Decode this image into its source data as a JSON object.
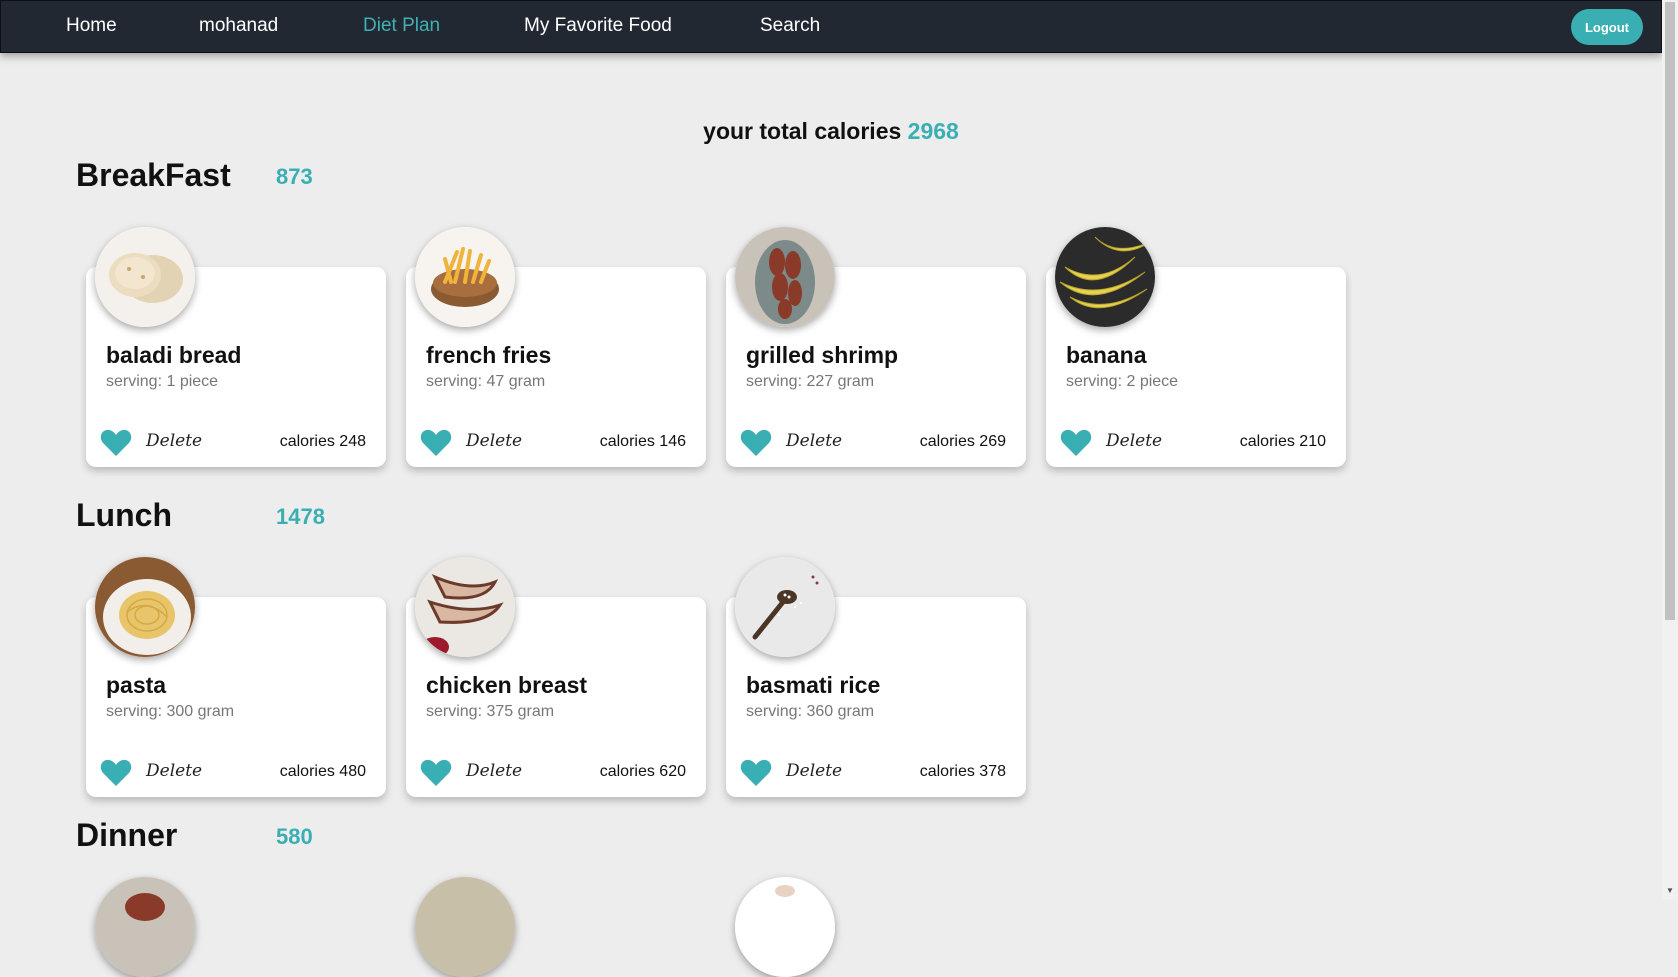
{
  "nav": {
    "items": [
      "Home",
      "mohanad",
      "Diet Plan",
      "My Favorite Food",
      "Search"
    ],
    "active": "Diet Plan",
    "logout_label": "Logout"
  },
  "colors": {
    "accent": "#3aafb3",
    "navbar": "#222831",
    "background": "#ededed"
  },
  "summary": {
    "label": "your total calories",
    "total": "2968"
  },
  "delete_label": "Delete",
  "meals": [
    {
      "title": "BreakFast",
      "calories": "873",
      "foods": [
        {
          "name": "baladi bread",
          "serving": "serving: 1 piece",
          "calories": "calories 248",
          "icon": "baladi-bread-image"
        },
        {
          "name": "french fries",
          "serving": "serving: 47 gram",
          "calories": "calories 146",
          "icon": "french-fries-image"
        },
        {
          "name": "grilled shrimp",
          "serving": "serving: 227 gram",
          "calories": "calories 269",
          "icon": "grilled-shrimp-image"
        },
        {
          "name": "banana",
          "serving": "serving: 2 piece",
          "calories": "calories 210",
          "icon": "banana-image"
        }
      ]
    },
    {
      "title": "Lunch",
      "calories": "1478",
      "foods": [
        {
          "name": "pasta",
          "serving": "serving: 300 gram",
          "calories": "calories 480",
          "icon": "pasta-image"
        },
        {
          "name": "chicken breast",
          "serving": "serving: 375 gram",
          "calories": "calories 620",
          "icon": "chicken-breast-image"
        },
        {
          "name": "basmati rice",
          "serving": "serving: 360 gram",
          "calories": "calories 378",
          "icon": "basmati-rice-image"
        }
      ]
    },
    {
      "title": "Dinner",
      "calories": "580",
      "foods": []
    }
  ]
}
